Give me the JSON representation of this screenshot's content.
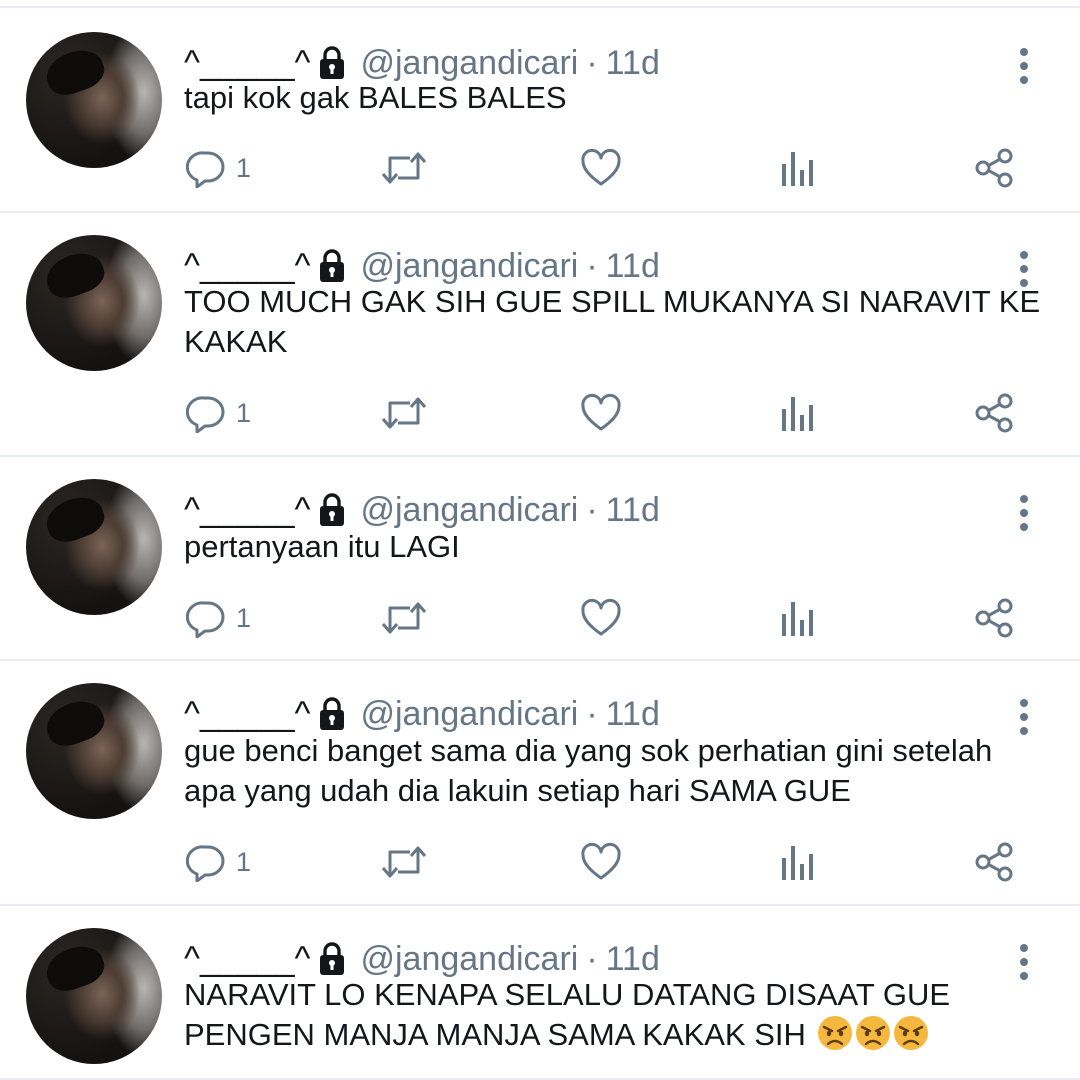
{
  "tweets": [
    {
      "display_name": "^_____^",
      "handle": "@jangandicari",
      "separator": "·",
      "time": "11d",
      "lines": [
        "tapi kok gak BALES BALES"
      ],
      "reply_count": "1",
      "emojis": 0
    },
    {
      "display_name": "^_____^",
      "handle": "@jangandicari",
      "separator": "·",
      "time": "11d",
      "lines": [
        "TOO MUCH GAK SIH GUE SPILL MUKANYA SI NARAVIT KE",
        "KAKAK"
      ],
      "reply_count": "1",
      "emojis": 0
    },
    {
      "display_name": "^_____^",
      "handle": "@jangandicari",
      "separator": "·",
      "time": "11d",
      "lines": [
        "pertanyaan itu LAGI"
      ],
      "reply_count": "1",
      "emojis": 0
    },
    {
      "display_name": "^_____^",
      "handle": "@jangandicari",
      "separator": "·",
      "time": "11d",
      "lines": [
        "gue benci banget sama dia yang sok perhatian gini setelah",
        "apa yang udah dia lakuin setiap hari SAMA GUE"
      ],
      "reply_count": "1",
      "emojis": 0
    },
    {
      "display_name": "^_____^",
      "handle": "@jangandicari",
      "separator": "·",
      "time": "11d",
      "lines": [
        "NARAVIT LO KENAPA SELALU DATANG DISAAT GUE",
        "PENGEN MANJA MANJA SAMA KAKAK SIH"
      ],
      "reply_count": "",
      "emojis": 3
    }
  ],
  "icons": {
    "lock": "lock-icon",
    "more": "more-vertical-icon",
    "reply": "reply-icon",
    "retweet": "retweet-icon",
    "like": "heart-icon",
    "analytics": "analytics-icon",
    "share": "share-icon",
    "emoji": "angry-face-emoji"
  },
  "colors": {
    "text": "#14171a",
    "secondary": "#657786",
    "divider": "#e6ecf0",
    "emoji": "#f5b73d"
  }
}
